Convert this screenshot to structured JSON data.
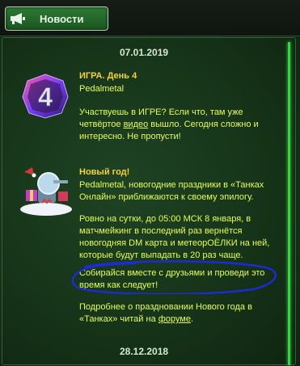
{
  "header": {
    "tab_label": "Новости",
    "tab_icon": "megaphone-icon"
  },
  "news": [
    {
      "date": "07.01.2019",
      "items": [
        {
          "icon": "day-4-badge-icon",
          "title": "ИГРА. День 4",
          "lines": [
            "Pedalmetal"
          ],
          "para1_a": "Участвуешь в ИГРЕ? Если что, там уже четвёртое ",
          "para1_link": "видео",
          "para1_b": " вышло. Сегодня сложно и интересно. Не пропусти!"
        },
        {
          "icon": "new-year-tank-icon",
          "title": "Новый год!",
          "para0": "Pedalmetal, новогодние праздники в «Танках Онлайн» приближаются к своему эпилогу.",
          "para1": "Ровно на сутки, до 05:00 МСК 8 января, в матчмейкинг в последний раз вернётся новогодняя DM карта и метеорОЁЛКИ на ней, которые будут выпадать в 20 раз чаще.",
          "para2": "Собирайся вместе с друзьями и проведи это время как следует!",
          "para3_a": "Подробнее о праздновании Нового года в «Танках» читай на ",
          "para3_link": "форуме",
          "para3_b": "."
        }
      ]
    },
    {
      "date": "28.12.2018"
    }
  ],
  "colors": {
    "title": "#f7d22b",
    "text": "#e5ff4a",
    "date": "#d9e6d0",
    "scrollbar": "#35d63f",
    "annotation": "#1c2bd6"
  }
}
